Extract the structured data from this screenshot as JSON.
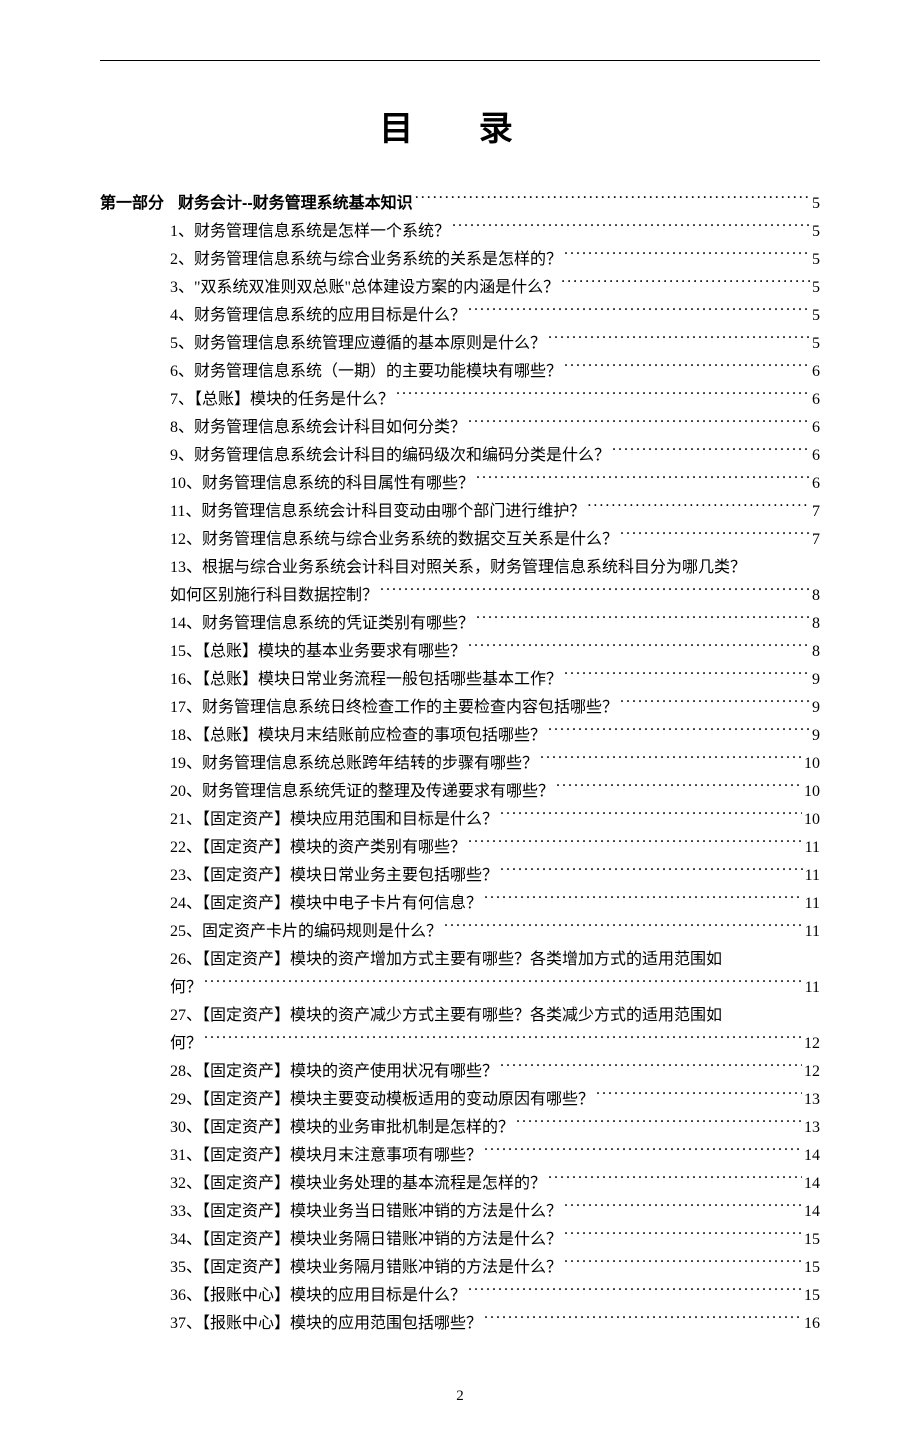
{
  "title": "目 录",
  "section": {
    "label": "第一部分",
    "title": "财务会计--财务管理系统基本知识",
    "page": "5"
  },
  "toc": [
    {
      "text": "1、财务管理信息系统是怎样一个系统？",
      "page": "5"
    },
    {
      "text": "2、财务管理信息系统与综合业务系统的关系是怎样的？",
      "page": "5"
    },
    {
      "text": "3、\"双系统双准则双总账\"总体建设方案的内涵是什么？",
      "page": "5"
    },
    {
      "text": "4、财务管理信息系统的应用目标是什么？",
      "page": "5"
    },
    {
      "text": "5、财务管理信息系统管理应遵循的基本原则是什么？",
      "page": "5"
    },
    {
      "text": "6、财务管理信息系统（一期）的主要功能模块有哪些？",
      "page": "6"
    },
    {
      "text": "7、【总账】模块的任务是什么？",
      "page": "6"
    },
    {
      "text": "8、财务管理信息系统会计科目如何分类？",
      "page": "6"
    },
    {
      "text": "9、财务管理信息系统会计科目的编码级次和编码分类是什么？",
      "page": "6"
    },
    {
      "text": "10、财务管理信息系统的科目属性有哪些？",
      "page": "6"
    },
    {
      "text": "11、财务管理信息系统会计科目变动由哪个部门进行维护？",
      "page": "7"
    },
    {
      "text": "12、财务管理信息系统与综合业务系统的数据交互关系是什么？",
      "page": "7"
    },
    {
      "text": "13、根据与综合业务系统会计科目对照关系，财务管理信息系统科目分为哪几类？",
      "text2": "如何区别施行科目数据控制？",
      "page": "8",
      "wrap": true
    },
    {
      "text": "14、财务管理信息系统的凭证类别有哪些？",
      "page": "8"
    },
    {
      "text": "15、【总账】模块的基本业务要求有哪些？",
      "page": "8"
    },
    {
      "text": "16、【总账】模块日常业务流程一般包括哪些基本工作？",
      "page": "9"
    },
    {
      "text": "17、财务管理信息系统日终检查工作的主要检查内容包括哪些？",
      "page": "9"
    },
    {
      "text": "18、【总账】模块月末结账前应检查的事项包括哪些？",
      "page": "9"
    },
    {
      "text": "19、财务管理信息系统总账跨年结转的步骤有哪些？",
      "page": "10"
    },
    {
      "text": "20、财务管理信息系统凭证的整理及传递要求有哪些？",
      "page": "10"
    },
    {
      "text": "21、【固定资产】模块应用范围和目标是什么？",
      "page": "10"
    },
    {
      "text": "22、【固定资产】模块的资产类别有哪些？",
      "page": "11"
    },
    {
      "text": "23、【固定资产】模块日常业务主要包括哪些？",
      "page": "11"
    },
    {
      "text": "24、【固定资产】模块中电子卡片有何信息？",
      "page": "11"
    },
    {
      "text": "25、固定资产卡片的编码规则是什么？",
      "page": "11"
    },
    {
      "text": "26、【固定资产】模块的资产增加方式主要有哪些？各类增加方式的适用范围如",
      "text2": "何？",
      "page": "11",
      "wrap": true
    },
    {
      "text": "27、【固定资产】模块的资产减少方式主要有哪些？各类减少方式的适用范围如",
      "text2": "何？",
      "page": "12",
      "wrap": true
    },
    {
      "text": "28、【固定资产】模块的资产使用状况有哪些？",
      "page": "12"
    },
    {
      "text": "29、【固定资产】模块主要变动模板适用的变动原因有哪些？",
      "page": "13"
    },
    {
      "text": "30、【固定资产】模块的业务审批机制是怎样的？",
      "page": "13"
    },
    {
      "text": "31、【固定资产】模块月末注意事项有哪些？",
      "page": "14"
    },
    {
      "text": "32、【固定资产】模块业务处理的基本流程是怎样的？",
      "page": "14"
    },
    {
      "text": "33、【固定资产】模块业务当日错账冲销的方法是什么？",
      "page": "14"
    },
    {
      "text": "34、【固定资产】模块业务隔日错账冲销的方法是什么？",
      "page": "15"
    },
    {
      "text": "35、【固定资产】模块业务隔月错账冲销的方法是什么？",
      "page": "15"
    },
    {
      "text": "36、【报账中心】模块的应用目标是什么？",
      "page": "15"
    },
    {
      "text": "37、【报账中心】模块的应用范围包括哪些？",
      "page": "16"
    }
  ],
  "footer_page": "2"
}
